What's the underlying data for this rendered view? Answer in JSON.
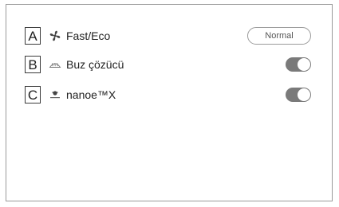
{
  "rows": [
    {
      "callout": "A",
      "icon": "fan-icon",
      "label": "Fast/Eco",
      "control": "button",
      "value": "Normal"
    },
    {
      "callout": "B",
      "icon": "defroster-icon",
      "label": "Buz çözücü",
      "control": "toggle",
      "state": "on"
    },
    {
      "callout": "C",
      "icon": "nanoe-icon",
      "label": "nanoe™X",
      "control": "toggle",
      "state": "on"
    }
  ],
  "colors": {
    "toggle_on": "#7a7a7a",
    "border": "#9a9a9a",
    "text": "#222222"
  }
}
